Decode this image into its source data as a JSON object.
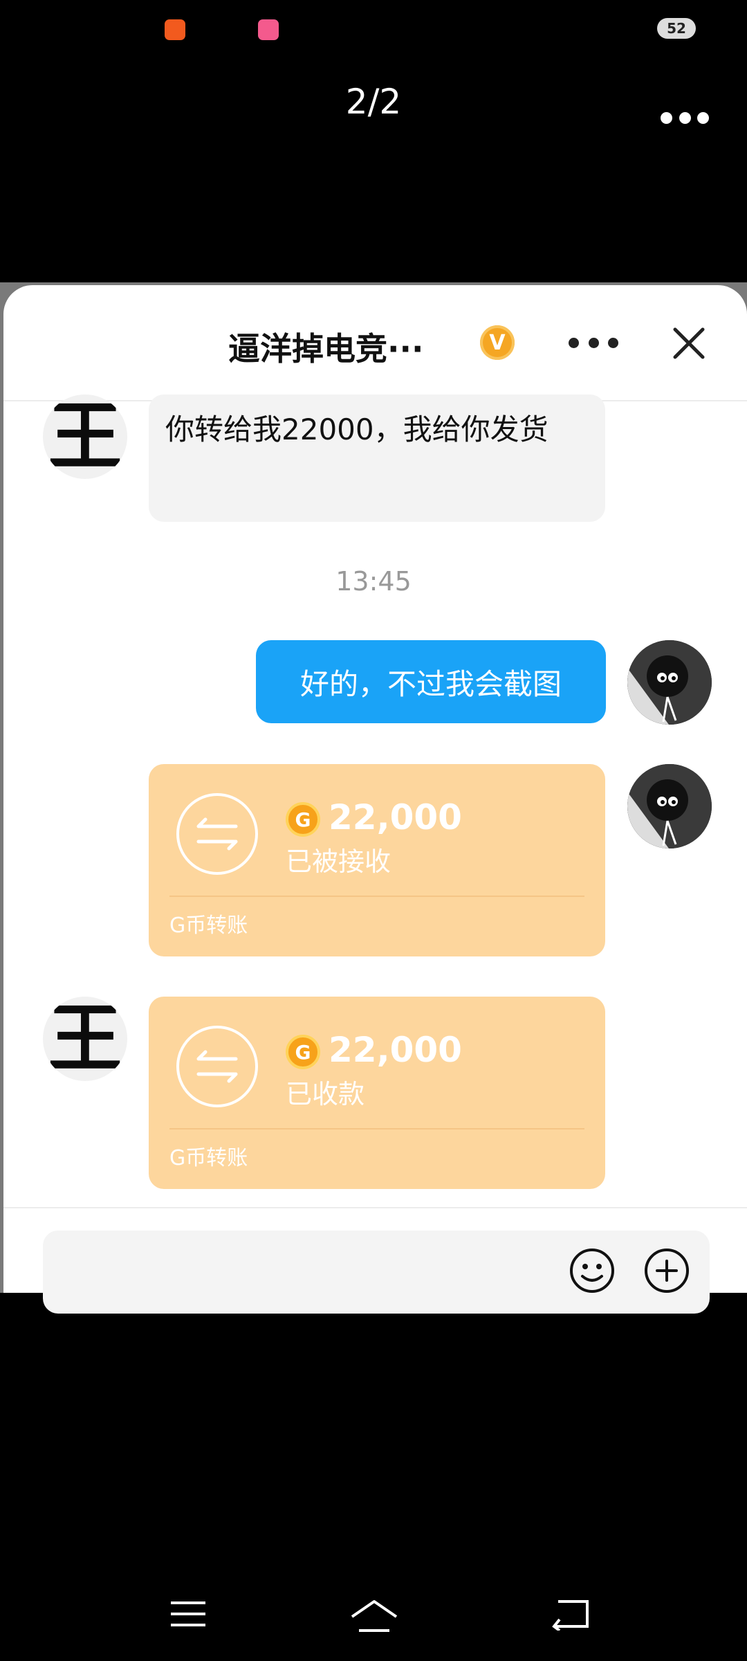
{
  "viewer": {
    "counter": "2/2"
  },
  "status_bar": {
    "battery": "52"
  },
  "chat": {
    "title": "逼洋掉电竞···",
    "badge": "V"
  },
  "messages": {
    "incoming_text": "你转给我22000，我给你发货",
    "time": "13:45",
    "outgoing_text": "好的，不过我会截图",
    "transfer_sent": {
      "amount": "22,000",
      "status": "已被接收",
      "label": "G币转账",
      "coin": "G"
    },
    "transfer_received": {
      "amount": "22,000",
      "status": "已收款",
      "label": "G币转账",
      "coin": "G"
    }
  },
  "avatar_other": {
    "glyph": "王"
  },
  "colors": {
    "blue_bubble": "#1aa3f7",
    "transfer_card": "#fdd69d",
    "coin": "#f7a21a",
    "vip_badge": "#f5a623"
  },
  "icons": [
    "app-shortcut-icon",
    "app-bilibili-icon",
    "more-icon",
    "close-icon",
    "transfer-icon",
    "coin-icon",
    "emoji-icon",
    "plus-icon",
    "menu-icon",
    "home-icon",
    "back-icon"
  ]
}
